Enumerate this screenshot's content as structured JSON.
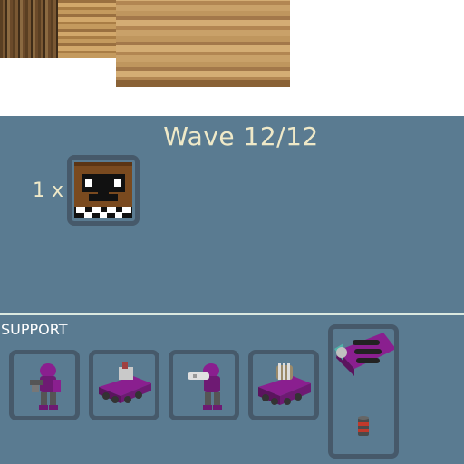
{
  "hud": {
    "wave_label": "Wave 12/12",
    "enemy_count": "1 x",
    "enemy_icon": "freddy-bear-head-icon"
  },
  "support": {
    "label": "SUPPORT",
    "items": [
      {
        "icon": "purple-mech-soldier-icon"
      },
      {
        "icon": "purple-tank-icon"
      },
      {
        "icon": "purple-cannon-soldier-icon"
      },
      {
        "icon": "purple-gatling-tank-icon"
      },
      {
        "icon": "purple-drill-vehicle-icon",
        "sub_icon": "barrel-icon"
      }
    ]
  },
  "colors": {
    "panel": "#5a7b91",
    "slot_border": "#46596a",
    "text": "#efe9c8",
    "unit_purple": "#8a1f8f"
  }
}
